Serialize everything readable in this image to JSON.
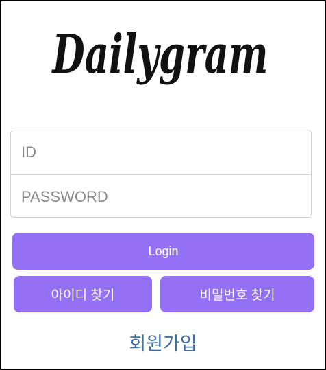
{
  "logo": {
    "text": "Dailygram"
  },
  "login_form": {
    "id_placeholder": "ID",
    "password_placeholder": "PASSWORD",
    "login_label": "Login",
    "find_id_label": "아이디 찾기",
    "find_password_label": "비밀번호 찾기",
    "signup_label": "회원가입"
  },
  "colors": {
    "button_bg": "#9370f4",
    "button_text": "#ffffff",
    "link": "#3a6fa8",
    "border": "#000000"
  }
}
